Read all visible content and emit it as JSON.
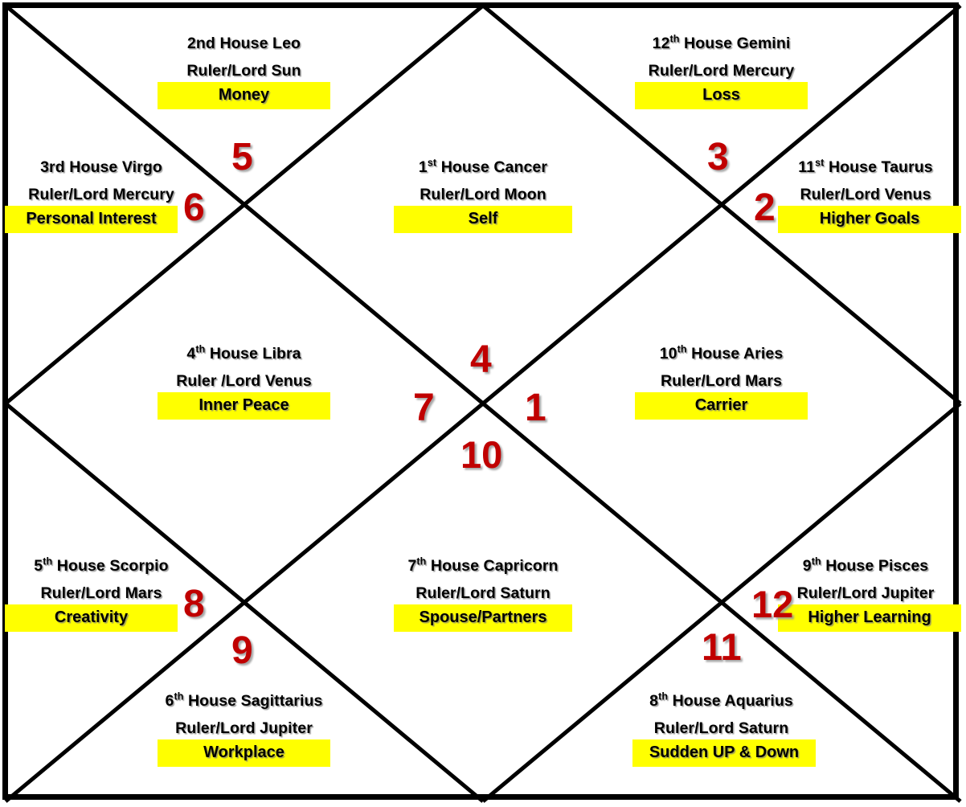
{
  "chart": {
    "type": "vedic-birth-chart-north-indian",
    "accent_red": "#C00000",
    "highlight_yellow": "#FFFF00",
    "line_color": "#000000"
  },
  "houses": [
    {
      "number": "1",
      "title_prefix": "1",
      "title_suffix": "st",
      "title_rest": " House  Cancer",
      "ruler": "Ruler/Lord Moon",
      "keyword": "Self",
      "sign": "Cancer",
      "lord": "Moon"
    },
    {
      "number": "2",
      "title_plain": "2nd House  Leo",
      "ruler": "Ruler/Lord Sun",
      "keyword": "Money",
      "sign": "Leo",
      "lord": "Sun"
    },
    {
      "number": "3",
      "title_plain": "3rd House  Virgo",
      "ruler": "Ruler/Lord Mercury",
      "keyword": "Personal Interest",
      "sign": "Virgo",
      "lord": "Mercury"
    },
    {
      "number": "4",
      "title_prefix": "4",
      "title_suffix": "th",
      "title_rest": " House Libra",
      "ruler": "Ruler /Lord Venus",
      "keyword": "Inner Peace",
      "sign": "Libra",
      "lord": "Venus"
    },
    {
      "number": "5",
      "title_prefix": "5",
      "title_suffix": "th",
      "title_rest": " House Scorpio",
      "ruler": "Ruler/Lord Mars",
      "keyword": "Creativity",
      "sign": "Scorpio",
      "lord": "Mars"
    },
    {
      "number": "6",
      "title_prefix": "6",
      "title_suffix": "th",
      "title_rest": " House Sagittarius",
      "ruler": "Ruler/Lord Jupiter",
      "keyword": "Workplace",
      "sign": "Sagittarius",
      "lord": "Jupiter"
    },
    {
      "number": "7",
      "title_prefix": "7",
      "title_suffix": "th",
      "title_rest": " House  Capricorn",
      "ruler": "Ruler/Lord Saturn",
      "keyword": "Spouse/Partners",
      "sign": "Capricorn",
      "lord": "Saturn"
    },
    {
      "number": "8",
      "title_prefix": "8",
      "title_suffix": "th",
      "title_rest": " House  Aquarius",
      "ruler": "Ruler/Lord Saturn",
      "keyword": "Sudden UP & Down",
      "sign": "Aquarius",
      "lord": "Saturn"
    },
    {
      "number": "9",
      "title_prefix": "9",
      "title_suffix": "th",
      "title_rest": " House  Pisces",
      "ruler": "Ruler/Lord Jupiter",
      "keyword": "Higher Learning",
      "sign": "Pisces",
      "lord": "Jupiter"
    },
    {
      "number": "10",
      "title_prefix": "10",
      "title_suffix": "th",
      "title_rest": " House  Aries",
      "ruler": "Ruler/Lord Mars",
      "keyword": "Carrier",
      "sign": "Aries",
      "lord": "Mars"
    },
    {
      "number": "11",
      "title_prefix": "11",
      "title_suffix": "st",
      "title_rest": " House Taurus",
      "ruler": "Ruler/Lord Venus",
      "keyword": "Higher Goals",
      "sign": "Taurus",
      "lord": "Venus"
    },
    {
      "number": "12",
      "title_prefix": "12",
      "title_suffix": "th",
      "title_rest": " House  Gemini",
      "ruler": "Ruler/Lord Mercury",
      "keyword": "Loss",
      "sign": "Gemini",
      "lord": "Mercury"
    }
  ],
  "house_numbers": {
    "n1": "1",
    "n2": "2",
    "n3": "3",
    "n4": "4",
    "n5": "5",
    "n6": "6",
    "n7": "7",
    "n8": "8",
    "n9": "9",
    "n10": "10",
    "n11": "11",
    "n12": "12"
  }
}
